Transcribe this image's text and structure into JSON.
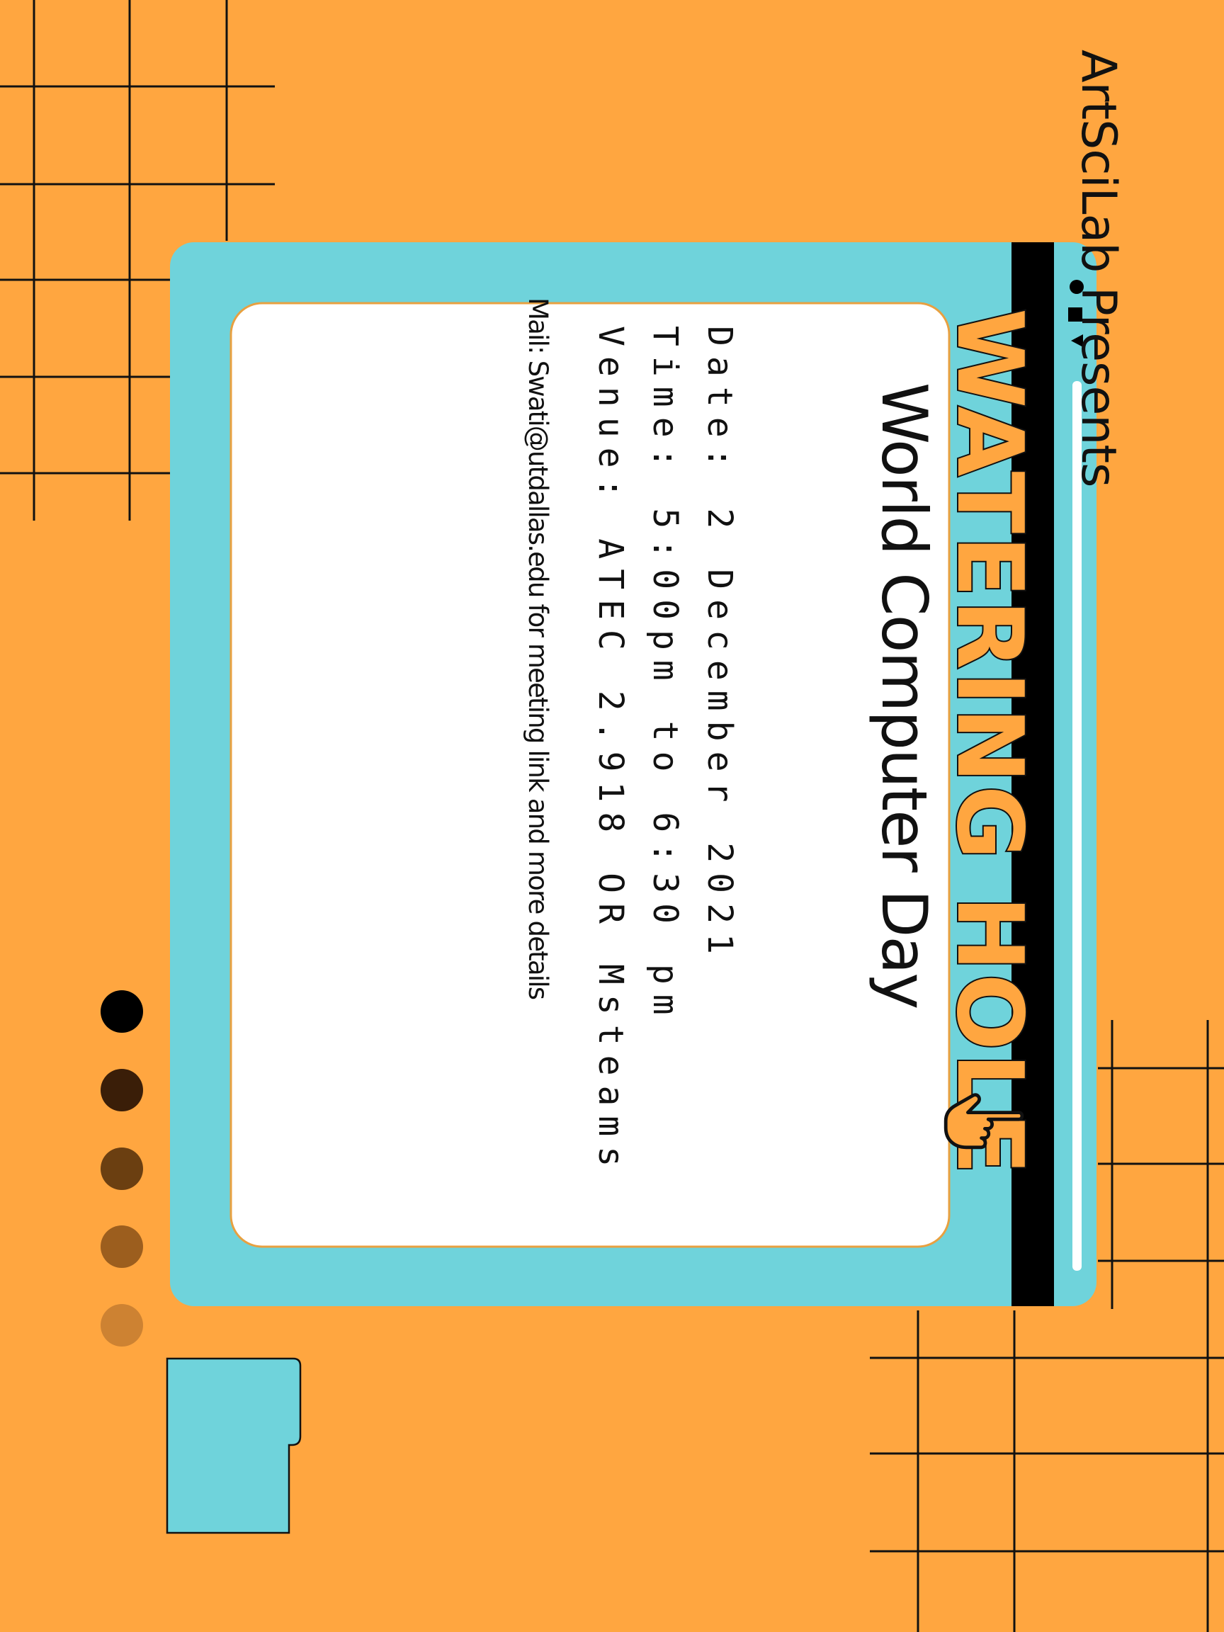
{
  "colors": {
    "background": "#FFA640",
    "window_cyan": "#6FD3DB",
    "card_white": "#FFFFFF",
    "ink": "#111111"
  },
  "header": {
    "brand": "ArtSciLab Presents"
  },
  "event": {
    "title": "WATERING HOLE",
    "subtitle": "World Computer Day",
    "date": "Date: 2 December 2021",
    "time": "Time: 5:00pm to 6:30 pm",
    "venue": "Venue: ATEC 2.918 OR Msteams",
    "mail": "Mail: Swati@utdallas.edu for meeting link and more details"
  },
  "icons": {
    "pointer": "pointing-hand-icon",
    "window_controls": [
      "circle-icon",
      "square-icon",
      "triangle-icon"
    ],
    "folder": "folder-icon"
  },
  "swatches": [
    "#000000",
    "#3A1E08",
    "#6B3F11",
    "#9C5E1E",
    "#CD8232"
  ]
}
